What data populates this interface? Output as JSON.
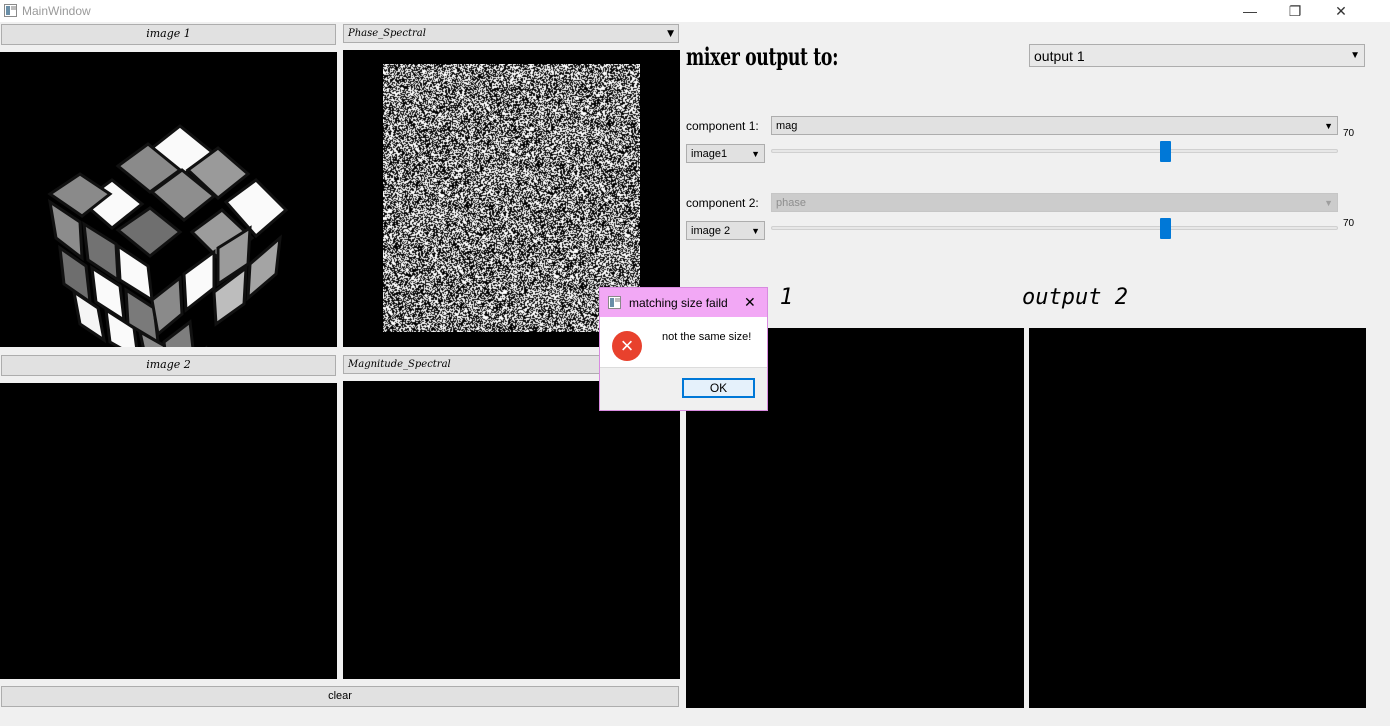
{
  "window": {
    "title": "MainWindow",
    "minimize": "—",
    "restore": "❐",
    "close": "✕"
  },
  "left": {
    "image1_button": "image 1",
    "image1_component_combo": "Phase_Spectral",
    "image2_button": "image 2",
    "image2_component_combo": "Magnitude_Spectral",
    "clear_button": "clear"
  },
  "mixer": {
    "title": "mixer output to:",
    "output_combo": "output 1",
    "component1_label": "component 1:",
    "component1_combo": "mag",
    "component1_source": "image1",
    "component1_value": "70",
    "component1_slider_fraction": 0.7,
    "component2_label": "component 2:",
    "component2_combo": "phase",
    "component2_source": "image 2",
    "component2_value": "70",
    "component2_slider_fraction": 0.7
  },
  "outputs": {
    "output1_label": "output 1",
    "output2_label": "output 2"
  },
  "dialog": {
    "title": "matching size faild",
    "close": "✕",
    "message": "not the same size!",
    "ok": "OK",
    "icon": "error-icon"
  },
  "colors": {
    "slider_handle": "#0078d7",
    "dialog_titlebar": "#f2a8f5",
    "error_icon": "#e8412d"
  },
  "icons": {
    "dropdown": "▼"
  }
}
